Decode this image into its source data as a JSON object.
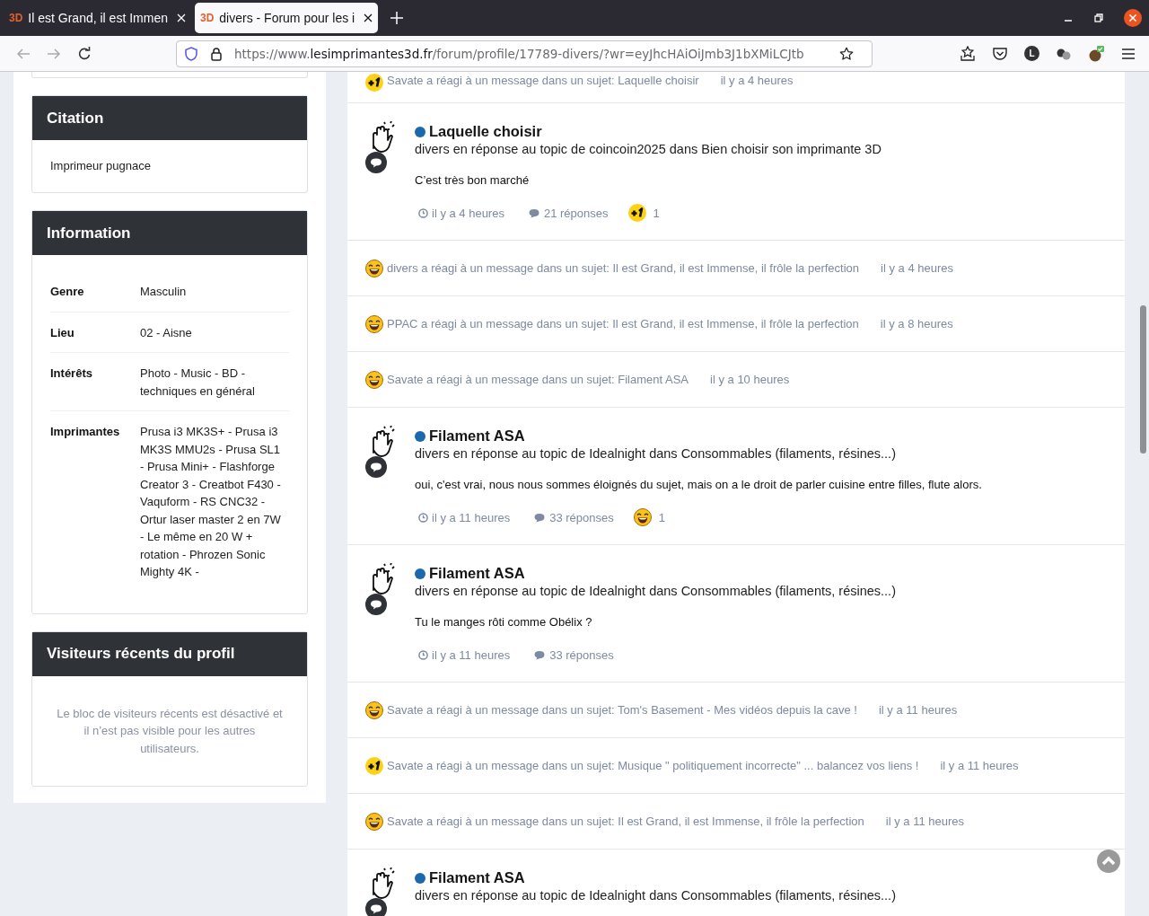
{
  "browser": {
    "tabs": [
      {
        "favicon": "3D",
        "title": "Il est Grand, il est Immen",
        "selected": false
      },
      {
        "favicon": "3D",
        "title": "divers - Forum pour les i",
        "selected": true
      }
    ],
    "url": {
      "prefix": "https://www.",
      "domain": "lesimprimantes3d.fr",
      "path": "/forum/profile/17789-divers/?wr=eyJhcHAiOiJmb3J1bXMiLCJtb"
    },
    "account_initial": "L"
  },
  "sidebar": {
    "cards": [
      {
        "kind": "text",
        "title": "Citation",
        "text": "Imprimeur pugnace"
      },
      {
        "kind": "fields",
        "title": "Information",
        "fields": [
          {
            "label": "Genre",
            "value": "Masculin"
          },
          {
            "label": "Lieu",
            "value": "02 - Aisne"
          },
          {
            "label": "Intérêts",
            "value": "Photo - Music - BD - techniques en général"
          },
          {
            "label": "Imprimantes",
            "value": "Prusa i3 MK3S+ - Prusa i3 MK3S MMU2s - Prusa SL1 - Prusa Mini+ - Flashforge Creator 3 - Creatbot F430 - Vaquform - RS CNC32 - Ortur laser master 2 en 7W - Le même en 20 W + rotation - Phrozen Sonic Mighty 4K -"
          }
        ]
      },
      {
        "kind": "notice",
        "title": "Visiteurs récents du profil",
        "text": "Le bloc de visiteurs récents est désactivé et il n’est pas visible pour les autres utilisateurs."
      }
    ]
  },
  "feed": [
    {
      "kind": "reaction",
      "icon": {
        "kind": "like"
      },
      "text": "Savate a réagi à un message dans un sujet: Laquelle choisir",
      "time": "il y a 4 heures"
    },
    {
      "kind": "post",
      "title": "Laquelle choisir",
      "subtitle": "divers en réponse au topic de coincoin2025 dans Bien choisir son imprimante 3D",
      "body": "C’est très bon marché",
      "time": "il y a 4 heures",
      "replies": "21 réponses",
      "reaction": {
        "kind": "like",
        "count": "1"
      }
    },
    {
      "kind": "reaction",
      "icon": {
        "kind": "haha"
      },
      "text": "divers a réagi à un message dans un sujet: Il est Grand, il est Immense, il frôle la perfection",
      "time": "il y a 4 heures"
    },
    {
      "kind": "reaction",
      "icon": {
        "kind": "haha"
      },
      "text": "PPAC a réagi à un message dans un sujet: Il est Grand, il est Immense, il frôle la perfection",
      "time": "il y a 8 heures"
    },
    {
      "kind": "reaction",
      "icon": {
        "kind": "haha"
      },
      "text": "Savate a réagi à un message dans un sujet: Filament ASA",
      "time": "il y a 10 heures"
    },
    {
      "kind": "post",
      "title": "Filament ASA",
      "subtitle": "divers en réponse au topic de Idealnight dans Consommables (filaments, résines...)",
      "body": "oui, c'est vrai, nous nous sommes éloignés du sujet, mais on a le droit de parler cuisine entre filles, flute alors.",
      "time": "il y a 11 heures",
      "replies": "33 réponses",
      "reaction": {
        "kind": "haha",
        "count": "1"
      }
    },
    {
      "kind": "post",
      "title": "Filament ASA",
      "subtitle": "divers en réponse au topic de Idealnight dans Consommables (filaments, résines...)",
      "body": "Tu le manges rôti comme Obélix ?",
      "time": "il y a 11 heures",
      "replies": "33 réponses"
    },
    {
      "kind": "reaction",
      "icon": {
        "kind": "haha"
      },
      "text": "Savate a réagi à un message dans un sujet: Tom's Basement - Mes vidéos depuis la cave !",
      "time": "il y a 11 heures"
    },
    {
      "kind": "reaction",
      "icon": {
        "kind": "like"
      },
      "text": "Savate a réagi à un message dans un sujet: Musique \" politiquement incorrecte\" ... balancez vos liens !",
      "time": "il y a 11 heures"
    },
    {
      "kind": "reaction",
      "icon": {
        "kind": "haha"
      },
      "text": "Savate a réagi à un message dans un sujet: Il est Grand, il est Immense, il frôle la perfection",
      "time": "il y a 11 heures"
    },
    {
      "kind": "post",
      "title": "Filament ASA",
      "subtitle": "divers en réponse au topic de Idealnight dans Consommables (filaments, résines...)"
    }
  ]
}
